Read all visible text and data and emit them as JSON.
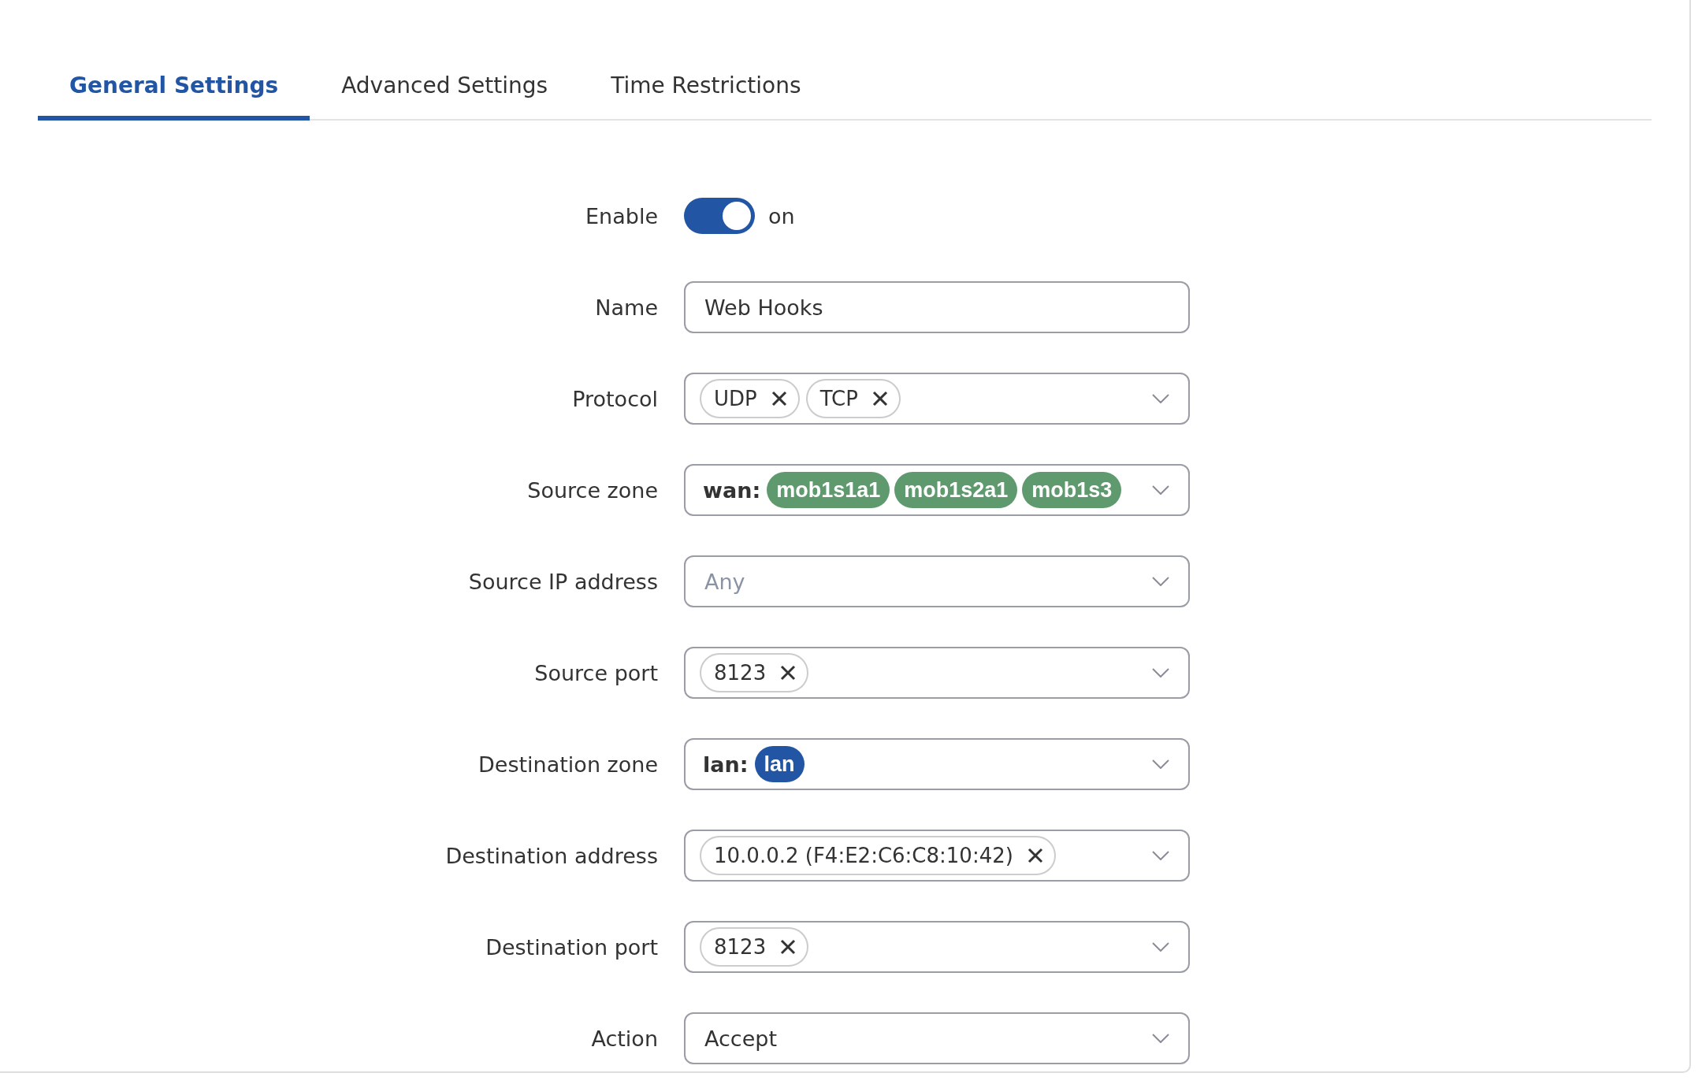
{
  "tabs": [
    {
      "label": "General Settings",
      "selected": true
    },
    {
      "label": "Advanced Settings",
      "selected": false
    },
    {
      "label": "Time Restrictions",
      "selected": false
    }
  ],
  "fields": [
    {
      "kind": "toggle",
      "label": "Enable",
      "on": true,
      "state_text": "on"
    },
    {
      "kind": "text",
      "label": "Name",
      "value": "Web Hooks"
    },
    {
      "kind": "tags",
      "label": "Protocol",
      "tags": [
        "UDP",
        "TCP"
      ]
    },
    {
      "kind": "zone",
      "label": "Source zone",
      "zone": "wan:",
      "chips": [
        {
          "text": "mob1s1a1",
          "color": "#5f9a6e"
        },
        {
          "text": "mob1s2a1",
          "color": "#5f9a6e"
        },
        {
          "text": "mob1s3",
          "color": "#5f9a6e"
        }
      ]
    },
    {
      "kind": "select",
      "label": "Source IP address",
      "placeholder": "Any"
    },
    {
      "kind": "tags",
      "label": "Source port",
      "tags": [
        "8123"
      ]
    },
    {
      "kind": "zone",
      "label": "Destination zone",
      "zone": "lan:",
      "chips": [
        {
          "text": "lan",
          "color": "#2255a4"
        }
      ]
    },
    {
      "kind": "tags",
      "label": "Destination address",
      "tags": [
        "10.0.0.2 (F4:E2:C6:C8:10:42)"
      ]
    },
    {
      "kind": "tags",
      "label": "Destination port",
      "tags": [
        "8123"
      ]
    },
    {
      "kind": "select",
      "label": "Action",
      "value": "Accept"
    }
  ]
}
